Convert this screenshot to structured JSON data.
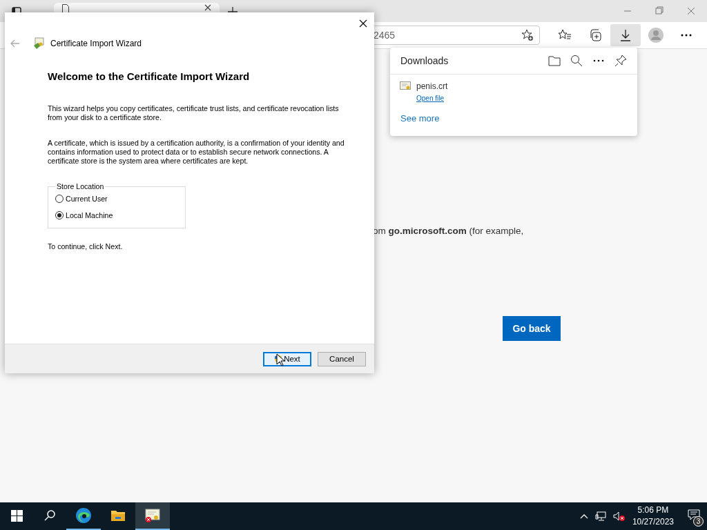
{
  "browser": {
    "address": {
      "text": "2465"
    },
    "downloads_button": {
      "selected": true
    },
    "downloads": {
      "title": "Downloads",
      "items": [
        {
          "name": "penis.crt",
          "action": "Open file"
        }
      ],
      "see_more": "See more"
    },
    "page": {
      "text": "om **go.microsoft.com** (for example,",
      "button": "Go back"
    }
  },
  "dialog": {
    "title": "Certificate Import Wizard",
    "heading": "Welcome to the Certificate Import Wizard",
    "paragraphs": [
      "This wizard helps you copy certificates, certificate trust lists, and certificate revocation lists from your disk to a certificate store.",
      "A certificate, which is issued by a certification authority, is a confirmation of your identity and contains information used to protect data or to establish secure network connections. A certificate store is the system area where certificates are kept."
    ],
    "store_location": {
      "label": "Store Location",
      "options": [
        {
          "label": "Current User",
          "selected": false
        },
        {
          "label": "Local Machine",
          "selected": true
        }
      ]
    },
    "instruction": "To continue, click Next.",
    "buttons": [
      {
        "label": "Next",
        "focused": true,
        "kind": "elevated"
      },
      {
        "label": "Cancel",
        "focused": false,
        "kind": "plain"
      }
    ]
  },
  "taskbar": {
    "apps": [
      {
        "kind": "edge",
        "running": true,
        "selected": false
      },
      {
        "kind": "explorer",
        "running": false,
        "selected": false
      },
      {
        "kind": "certificate",
        "running": true,
        "selected": true
      }
    ],
    "clock": {
      "time": "5:06 PM",
      "date": "10/27/2023"
    },
    "notifications": {
      "count": "3"
    }
  }
}
